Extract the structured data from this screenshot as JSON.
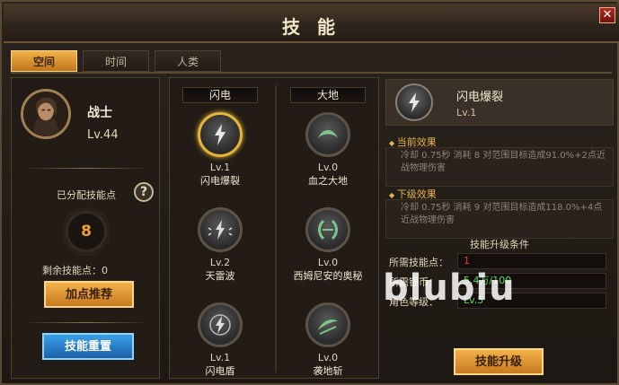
{
  "window": {
    "title": "技 能",
    "close_label": "✕"
  },
  "tabs": [
    {
      "label": "空间",
      "active": true
    },
    {
      "label": "时间",
      "active": false
    },
    {
      "label": "人类",
      "active": false
    }
  ],
  "character": {
    "name": "战士",
    "level": "Lv.44"
  },
  "points": {
    "allocated_label": "已分配技能点",
    "allocated_value": "8",
    "remaining_label": "剩余技能点：0",
    "help": "?"
  },
  "buttons": {
    "recommend": "加点推荐",
    "reset": "技能重置",
    "upgrade": "技能升级"
  },
  "columns": [
    {
      "header": "闪电",
      "skills": [
        {
          "level": "Lv.1",
          "name": "闪电爆裂",
          "icon": "lightning-icon",
          "selected": true
        },
        {
          "level": "Lv.2",
          "name": "天雷波",
          "icon": "lightning-burst-icon",
          "selected": false
        },
        {
          "level": "Lv.1",
          "name": "闪电盾",
          "icon": "lightning-shield-icon",
          "selected": false
        }
      ]
    },
    {
      "header": "大地",
      "skills": [
        {
          "level": "Lv.0",
          "name": "血之大地",
          "icon": "earth-arc-icon",
          "selected": false
        },
        {
          "level": "Lv.0",
          "name": "西姆尼安的奥秘",
          "icon": "earth-bracket-icon",
          "selected": false
        },
        {
          "level": "Lv.0",
          "name": "袭地斩",
          "icon": "earth-slash-icon",
          "selected": false
        }
      ]
    }
  ],
  "detail": {
    "name": "闪电爆裂",
    "level": "Lv.1",
    "current_title": "当前效果",
    "current_text": "冷却 0.75秒 消耗 8 对范围目标造成91.0%+2点近战物理伤害",
    "next_title": "下级效果",
    "next_text": "冷却 0.75秒 消耗 9 对范围目标造成118.0%+4点近战物理伤害",
    "conditions_title": "技能升级条件",
    "conditions": [
      {
        "label": "所需技能点：",
        "value": "1",
        "color": "#e0413a"
      },
      {
        "label": "所需银币：",
        "value": "5.4万/100",
        "color": "#5fd36a"
      },
      {
        "label": "角色等级：",
        "value": "Lv.5",
        "color": "#5fd36a"
      }
    ]
  },
  "watermark": "blubiu",
  "colors": {
    "accent": "#e8b24f",
    "orange_btn": "#f3b24b",
    "blue_btn": "#3aa0e8"
  }
}
